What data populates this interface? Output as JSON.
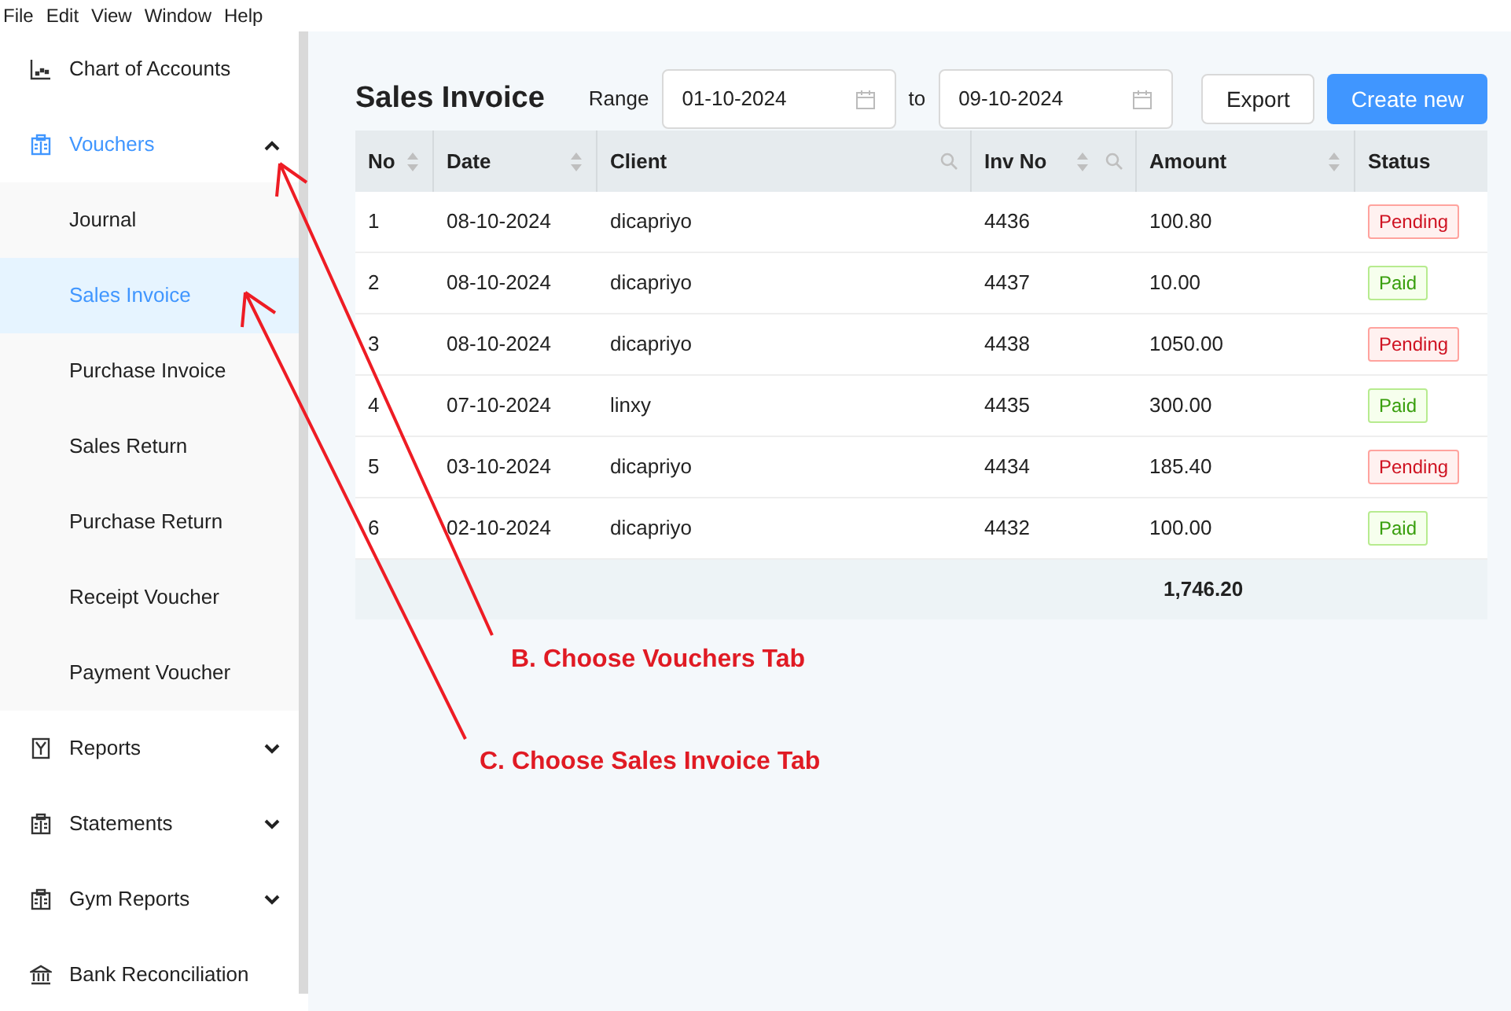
{
  "menu_bar": [
    "File",
    "Edit",
    "View",
    "Window",
    "Help"
  ],
  "sidebar": {
    "items": [
      {
        "label": "Chart of Accounts",
        "kind": "link",
        "selected": false
      },
      {
        "label": "Vouchers",
        "kind": "group",
        "selected": true,
        "expanded": true,
        "children": [
          {
            "label": "Journal",
            "selected": false
          },
          {
            "label": "Sales Invoice",
            "selected": true
          },
          {
            "label": "Purchase Invoice",
            "selected": false
          },
          {
            "label": "Sales Return",
            "selected": false
          },
          {
            "label": "Purchase Return",
            "selected": false
          },
          {
            "label": "Receipt Voucher",
            "selected": false
          },
          {
            "label": "Payment Voucher",
            "selected": false
          }
        ]
      },
      {
        "label": "Reports",
        "kind": "group",
        "selected": false,
        "expanded": false
      },
      {
        "label": "Statements",
        "kind": "group",
        "selected": false,
        "expanded": false
      },
      {
        "label": "Gym Reports",
        "kind": "group",
        "selected": false,
        "expanded": false
      },
      {
        "label": "Bank Reconciliation",
        "kind": "link",
        "selected": false
      }
    ]
  },
  "page": {
    "title": "Sales Invoice",
    "range_label": "Range",
    "from_date": "01-10-2024",
    "to_label": "to",
    "to_date": "09-10-2024",
    "buttons": [
      {
        "label": "Export",
        "kind": "secondary"
      },
      {
        "label": "Create new",
        "kind": "primary"
      }
    ]
  },
  "table": {
    "columns": [
      "No",
      "Date",
      "Client",
      "Inv No",
      "Amount",
      "Status"
    ],
    "rows": [
      {
        "no": "1",
        "date": "08-10-2024",
        "client": "dicapriyo",
        "inv_no": "4436",
        "amount": "100.80",
        "status": {
          "label": "Pending",
          "kind": "pending"
        }
      },
      {
        "no": "2",
        "date": "08-10-2024",
        "client": "dicapriyo",
        "inv_no": "4437",
        "amount": "10.00",
        "status": {
          "label": "Paid",
          "kind": "paid"
        }
      },
      {
        "no": "3",
        "date": "08-10-2024",
        "client": "dicapriyo",
        "inv_no": "4438",
        "amount": "1050.00",
        "status": {
          "label": "Pending",
          "kind": "pending"
        }
      },
      {
        "no": "4",
        "date": "07-10-2024",
        "client": "linxy",
        "inv_no": "4435",
        "amount": "300.00",
        "status": {
          "label": "Paid",
          "kind": "paid"
        }
      },
      {
        "no": "5",
        "date": "03-10-2024",
        "client": "dicapriyo",
        "inv_no": "4434",
        "amount": "185.40",
        "status": {
          "label": "Pending",
          "kind": "pending"
        }
      },
      {
        "no": "6",
        "date": "02-10-2024",
        "client": "dicapriyo",
        "inv_no": "4432",
        "amount": "100.00",
        "status": {
          "label": "Paid",
          "kind": "paid"
        }
      }
    ],
    "total": "1,746.20"
  },
  "annotations": [
    "B. Choose Vouchers Tab",
    "C. Choose Sales Invoice Tab"
  ]
}
